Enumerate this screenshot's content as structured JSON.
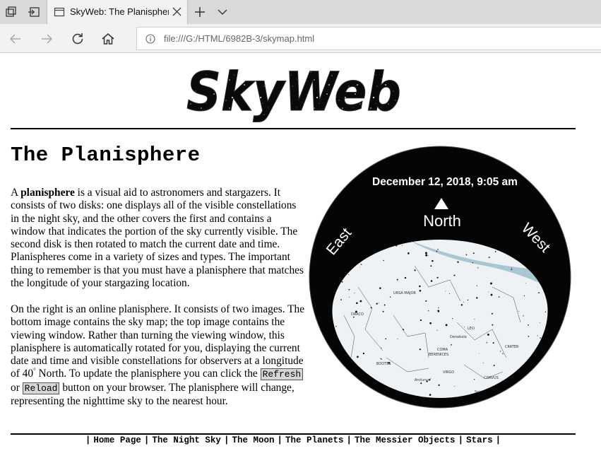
{
  "browser": {
    "tab_title": "SkyWeb: The Planispher",
    "url": "file:///G:/HTML/6982B-3/skymap.html"
  },
  "page": {
    "logo_text": "SkyWeb",
    "title": "The Planisphere",
    "para1_parts": {
      "a": "A ",
      "bold": "planisphere",
      "b": " is a visual aid to astronomers and stargazers. It consists of two disks: one displays all of the visible constellations in the night sky, and the other covers the first and contains a window that indicates the portion of the sky currently visible. The second disk is then rotated to match the current date and time. Planispheres come in a variety of sizes and types. The important thing to remember is that you must have a planisphere that matches the longitude of your stargazing location."
    },
    "para2_parts": {
      "a": "On the right is an online planisphere. It consists of two images. The bottom image contains the sky map; the top image contains the viewing window. Rather than turning the viewing window, this planisphere is automatically rotated for you, displaying the current date and time and visible constellations for observers at a longitude of 40",
      "sup": "°",
      "b": " North. To update the planisphere you can click the ",
      "refresh": "Refresh",
      "or": " or ",
      "reload": "Reload",
      "c": " button on your browser. The planisphere will change, representing the nighttime sky to the nearest hour."
    },
    "planisphere": {
      "date_label": "December 12, 2018, 9:05 am",
      "north": "North",
      "east": "East",
      "west": "West"
    },
    "footer_links": [
      "Home Page",
      "The Night Sky",
      "The Moon",
      "The Planets",
      "The Messier Objects",
      "Stars"
    ],
    "footer_sep": "|"
  }
}
